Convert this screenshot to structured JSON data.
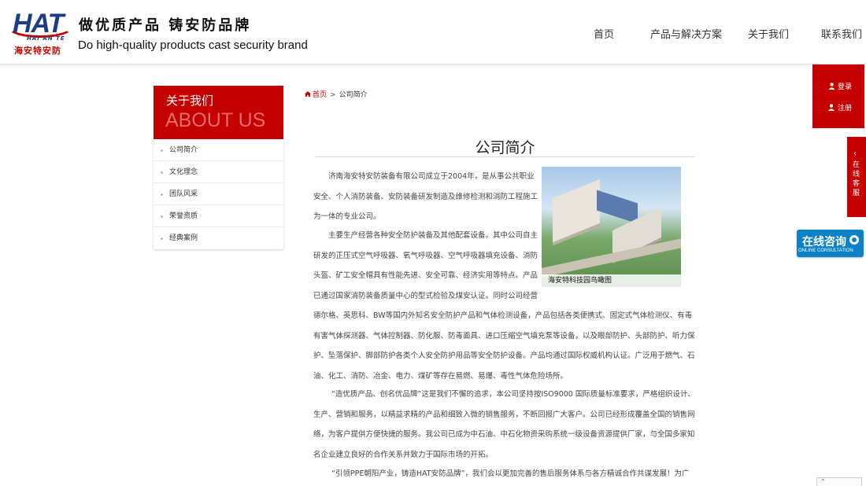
{
  "header": {
    "logo_main": "HAT",
    "logo_sub": "HAI AN TE",
    "logo_cn": "海安特安防",
    "slogan_cn": "做优质产品 铸安防品牌",
    "slogan_en": "Do high-quality products cast security brand",
    "nav": [
      "首页",
      "产品与解决方案",
      "关于我们",
      "联系我们"
    ]
  },
  "sidebar": {
    "title": "关于我们",
    "title_en": "ABOUT US",
    "items": [
      "公司简介",
      "文化理念",
      "团队风采",
      "荣誉资质",
      "经典案例"
    ]
  },
  "breadcrumb": {
    "home": "首页",
    "separator": ">",
    "current": "公司简介"
  },
  "content": {
    "title": "公司简介",
    "photo_caption": "海安特科技园鸟瞰图",
    "p1": "济南海安特安防装备有限公司成立于2004年，是从事公共职业安全、个人消防装备、安防装备研发制造及维修检测和消防工程施工为一体的专业公司。",
    "p2": "主要生产经营各种安全防护装备及其他配套设备。其中公司自主研发的正压式空气呼吸器、氧气呼吸器、空气呼吸器填充设备、消防头盔、矿工安全帽具有性能先进、安全可靠、经济实用等特点。产品已通过国家消防装备质量中心的型式检验及煤安认证。同时公司经营",
    "p2b": "德尔格、英思科、BW等国内外知名安全防护产品和气体检测设备，产品包括各类便携式、固定式气体检测仪、有毒有害气体探测器、气体控制器、防化服、防毒面具、进口压缩空气填充泵等设备，以及眼部防护、头部防护、听力保护、坠落保护、脚部防护各类个人安全防护用品等安全防护设备。产品均通过国际权威机构认证。广泛用于燃气、石油、化工、消防、冶金、电力、煤矿等存在易燃、易爆、毒性气体危险场所。",
    "p3": "“造优质产品、创名优品牌”这是我们不懈的追求，本公司坚持按ISO9000 国际质量标准要求，严格组织设计、生产、营销和服务，以精益求精的产品和细致入微的销售服务，不断回报广大客户。公司已经形成覆盖全国的销售网络，为客户提供方便快捷的服务。我公司已成为中石油、中石化物资采购系统一级设备资源提供厂家，与全国多家知名企业建立良好的合作关系并致力于国际市场的开拓。",
    "p4": "“引领PPE朝阳产业，铸造HAT安防品牌”，我们会以更加完善的售后服务体系与各方精诚合作共谋发展！为广"
  },
  "float": {
    "login": "登录",
    "register": "注册",
    "service": "在线客服",
    "online_cn": "在线咨询",
    "online_en": "ONLINE CONSULTATION"
  },
  "colors": {
    "brand_red": "#c40000",
    "brand_blue": "#1d3c86",
    "online_blue": "#0b82c6"
  }
}
